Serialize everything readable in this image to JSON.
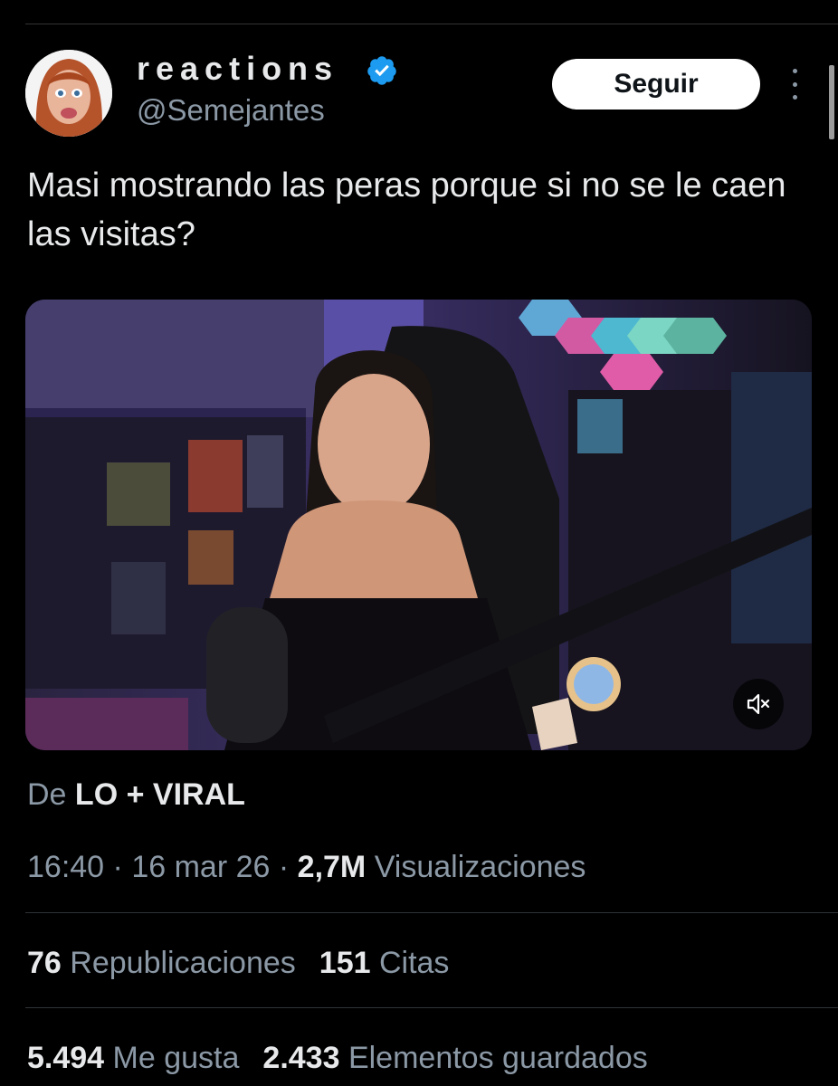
{
  "author": {
    "display_name": "reactions",
    "handle": "@Semejantes",
    "verified": true
  },
  "follow_label": "Seguir",
  "tweet_text": "Masi mostrando las peras porque si no se le caen las visitas?",
  "media": {
    "type": "video",
    "muted": true
  },
  "source": {
    "prefix": "De",
    "name": "LO + VIRAL"
  },
  "meta": {
    "time": "16:40",
    "separator": "·",
    "date": "16 mar 26",
    "views_count": "2,7M",
    "views_label": "Visualizaciones"
  },
  "stats": {
    "reposts_count": "76",
    "reposts_label": "Republicaciones",
    "quotes_count": "151",
    "quotes_label": "Citas",
    "likes_count": "5.494",
    "likes_label": "Me gusta",
    "bookmarks_count": "2.433",
    "bookmarks_label": "Elementos guardados"
  },
  "colors": {
    "background": "#000000",
    "text": "#e7e9ea",
    "secondary": "#8b98a5",
    "verified": "#1d9bf0",
    "divider": "#2f3336"
  }
}
